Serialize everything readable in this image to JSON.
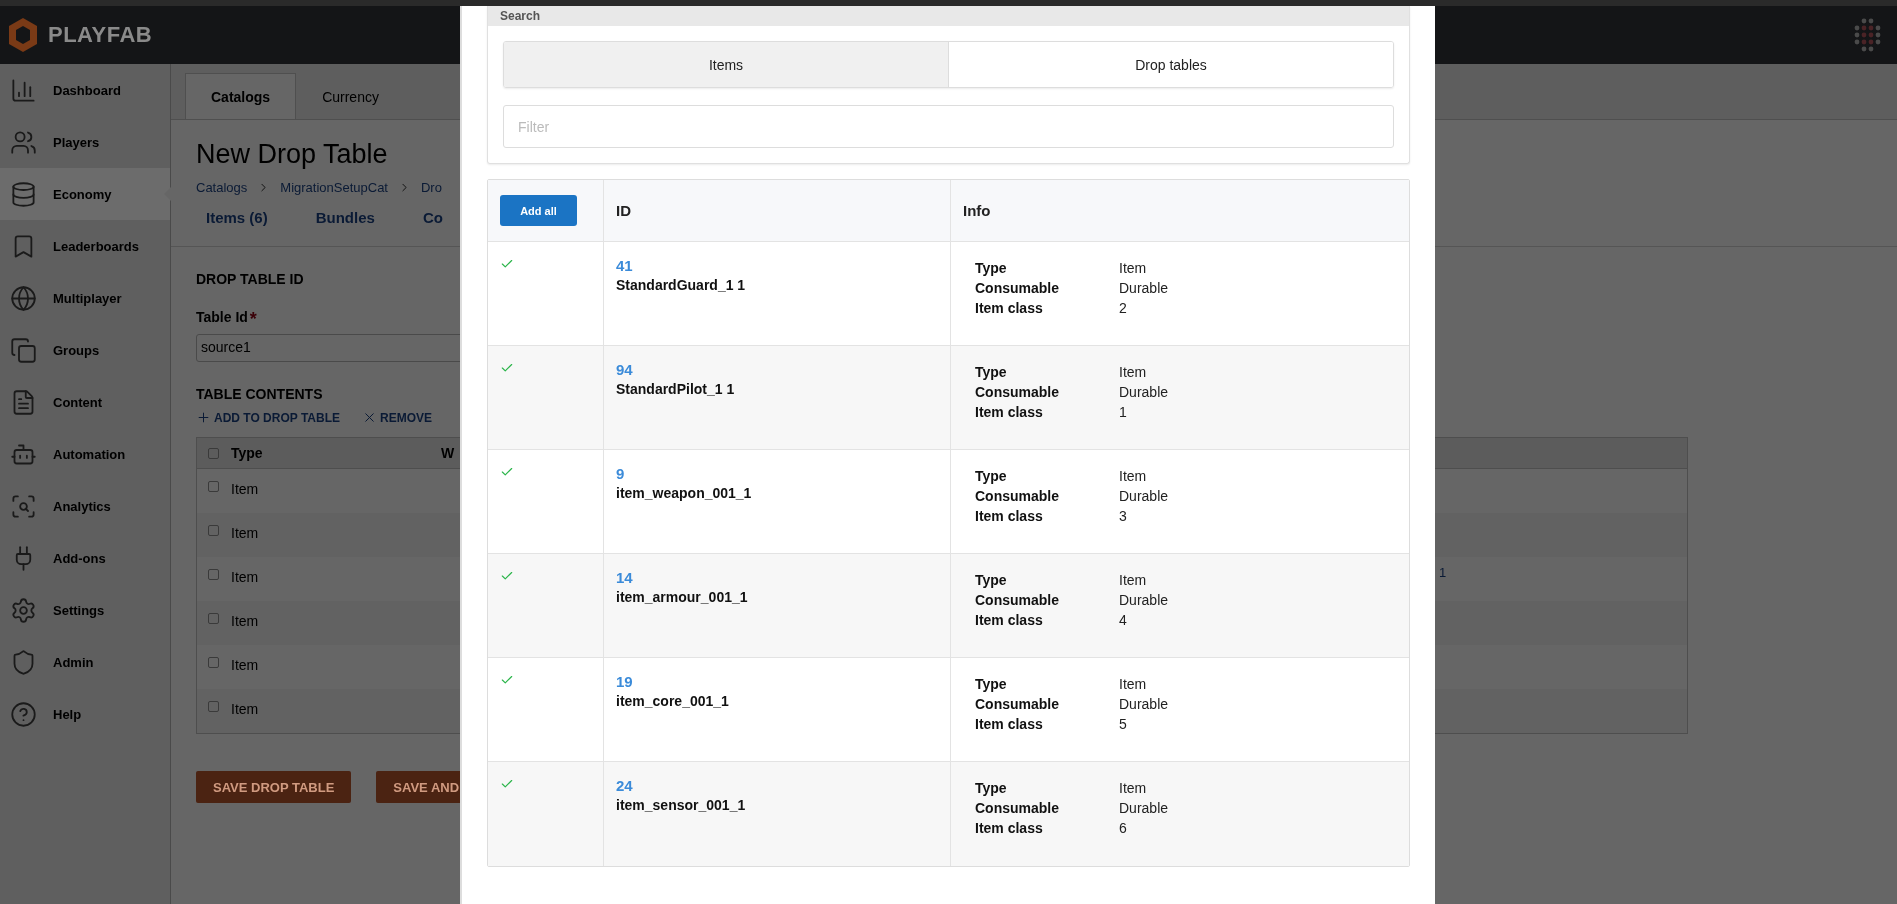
{
  "header": {
    "logo_text": "PLAYFAB"
  },
  "sidebar": {
    "items": [
      {
        "label": "Dashboard",
        "selected": false
      },
      {
        "label": "Players",
        "selected": false
      },
      {
        "label": "Economy",
        "selected": true
      },
      {
        "label": "Leaderboards",
        "selected": false
      },
      {
        "label": "Multiplayer",
        "selected": false
      },
      {
        "label": "Groups",
        "selected": false
      },
      {
        "label": "Content",
        "selected": false
      },
      {
        "label": "Automation",
        "selected": false
      },
      {
        "label": "Analytics",
        "selected": false
      },
      {
        "label": "Add-ons",
        "selected": false
      },
      {
        "label": "Settings",
        "selected": false
      },
      {
        "label": "Admin",
        "selected": false
      },
      {
        "label": "Help",
        "selected": false
      }
    ]
  },
  "page": {
    "tabs": [
      {
        "label": "Catalogs",
        "selected": true
      },
      {
        "label": "Currency",
        "selected": false
      }
    ],
    "title": "New Drop Table",
    "breadcrumbs": [
      "Catalogs",
      "MigrationSetupCat",
      "Dro"
    ],
    "subtabs": [
      "Items (6)",
      "Bundles",
      "Co"
    ],
    "id_heading": "DROP TABLE ID",
    "table_id": {
      "label": "Table Id",
      "required_mark": "*",
      "value": "source1"
    },
    "contents_heading": "TABLE CONTENTS",
    "actions": [
      {
        "kind": "add",
        "label": "ADD TO DROP TABLE"
      },
      {
        "kind": "remove",
        "label": "REMOVE"
      }
    ],
    "table": {
      "all_checked": false,
      "columns": [
        "Type",
        "W"
      ],
      "rows": [
        {
          "type": "Item",
          "checked": false
        },
        {
          "type": "Item",
          "checked": false
        },
        {
          "type": "Item",
          "checked": false,
          "column_3": "1"
        },
        {
          "type": "Item",
          "checked": false
        },
        {
          "type": "Item",
          "checked": false
        },
        {
          "type": "Item",
          "checked": false
        }
      ]
    },
    "buttons": [
      "SAVE DROP TABLE",
      "SAVE AND"
    ]
  },
  "modal": {
    "search": {
      "title": "Search",
      "tabs": [
        {
          "label": "Items",
          "selected": true
        },
        {
          "label": "Drop tables",
          "selected": false
        }
      ],
      "filter": {
        "placeholder": "Filter"
      }
    },
    "add_all": "Add all",
    "columns": [
      "ID",
      "Info"
    ],
    "rows": [
      {
        "added": true,
        "id": "41",
        "name": "StandardGuard_1 1",
        "info": [
          {
            "label": "Type",
            "value": "Item"
          },
          {
            "label": "Consumable",
            "value": "Durable"
          },
          {
            "label": "Item class",
            "value": "2"
          }
        ]
      },
      {
        "added": true,
        "id": "94",
        "name": "StandardPilot_1 1",
        "info": [
          {
            "label": "Type",
            "value": "Item"
          },
          {
            "label": "Consumable",
            "value": "Durable"
          },
          {
            "label": "Item class",
            "value": "1"
          }
        ]
      },
      {
        "added": true,
        "id": "9",
        "name": "item_weapon_001_1",
        "info": [
          {
            "label": "Type",
            "value": "Item"
          },
          {
            "label": "Consumable",
            "value": "Durable"
          },
          {
            "label": "Item class",
            "value": "3"
          }
        ]
      },
      {
        "added": true,
        "id": "14",
        "name": "item_armour_001_1",
        "info": [
          {
            "label": "Type",
            "value": "Item"
          },
          {
            "label": "Consumable",
            "value": "Durable"
          },
          {
            "label": "Item class",
            "value": "4"
          }
        ]
      },
      {
        "added": true,
        "id": "19",
        "name": "item_core_001_1",
        "info": [
          {
            "label": "Type",
            "value": "Item"
          },
          {
            "label": "Consumable",
            "value": "Durable"
          },
          {
            "label": "Item class",
            "value": "5"
          }
        ]
      },
      {
        "added": true,
        "id": "24",
        "name": "item_sensor_001_1",
        "info": [
          {
            "label": "Type",
            "value": "Item"
          },
          {
            "label": "Consumable",
            "value": "Durable"
          },
          {
            "label": "Item class",
            "value": "6"
          }
        ]
      }
    ]
  }
}
